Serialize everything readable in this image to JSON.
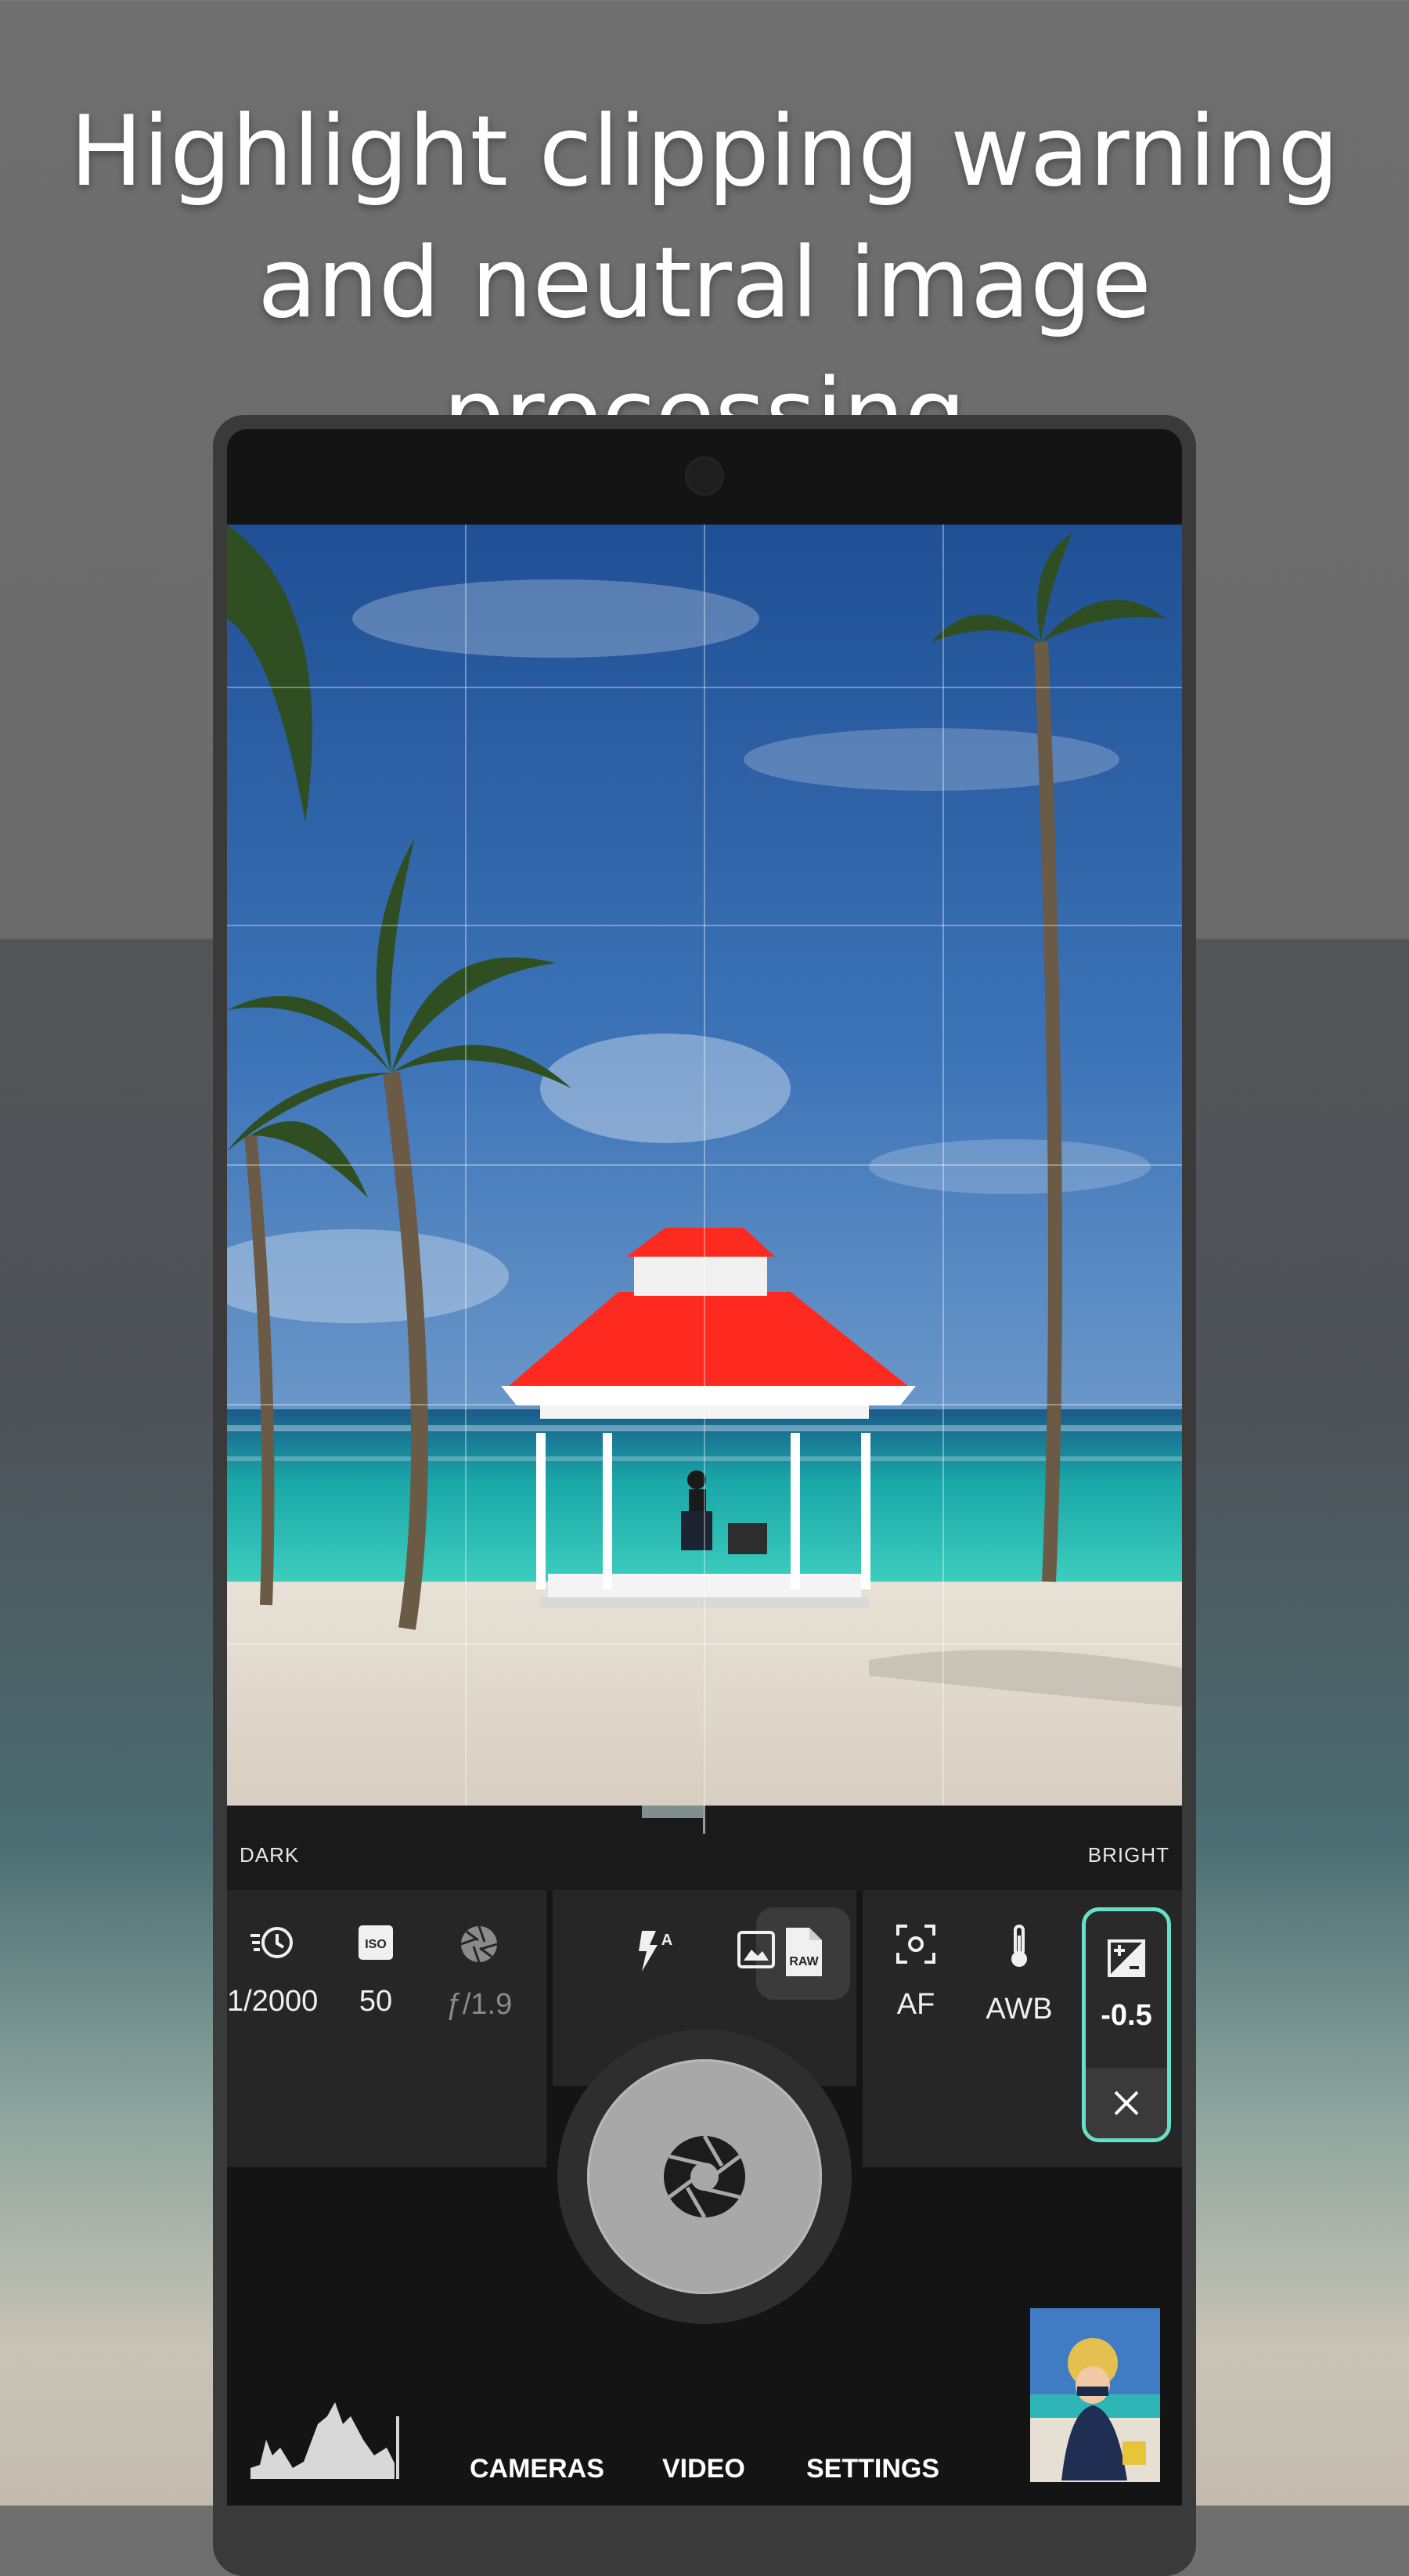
{
  "headline": {
    "line1": "Highlight clipping warning",
    "line2": "and neutral image processing"
  },
  "meter": {
    "dark_label": "DARK",
    "bright_label": "BRIGHT"
  },
  "controls": {
    "shutter_speed": "1/2000",
    "iso": "50",
    "aperture": "ƒ/1.9",
    "focus": "AF",
    "white_balance": "AWB",
    "exposure_compensation": "-0.5"
  },
  "modes": {
    "flash": "flash-auto-icon",
    "image": "image-format-icon",
    "raw": "raw-icon"
  },
  "nav": {
    "cameras": "CAMERAS",
    "video": "VIDEO",
    "settings": "SETTINGS"
  },
  "colors": {
    "accent": "#66e0c8",
    "clipping_warning": "#ff2a1f",
    "panel": "#262626"
  },
  "icons": [
    "shutter-speed-icon",
    "iso-icon",
    "aperture-icon",
    "flash-auto-icon",
    "image-icon",
    "raw-file-icon",
    "focus-icon",
    "thermometer-icon",
    "exposure-icon",
    "close-icon",
    "shutter-icon",
    "histogram-icon"
  ]
}
